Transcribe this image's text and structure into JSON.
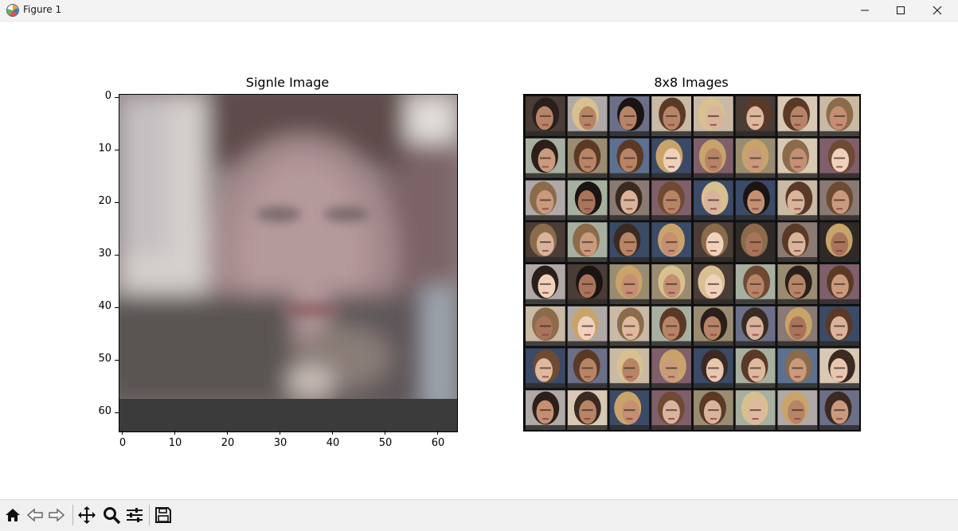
{
  "window": {
    "title": "Figure 1"
  },
  "figure": {
    "left_axes": {
      "title": "Signle Image",
      "y_ticks": [
        "0",
        "10",
        "20",
        "30",
        "40",
        "50",
        "60"
      ],
      "x_ticks": [
        "0",
        "10",
        "20",
        "30",
        "40",
        "50",
        "60"
      ]
    },
    "right_axes": {
      "title": "8x8 Images"
    }
  },
  "toolbar": {
    "buttons": [
      "home-icon",
      "back-icon",
      "forward-icon",
      "pan-icon",
      "zoom-icon",
      "configure-subplots-icon",
      "save-icon"
    ]
  }
}
